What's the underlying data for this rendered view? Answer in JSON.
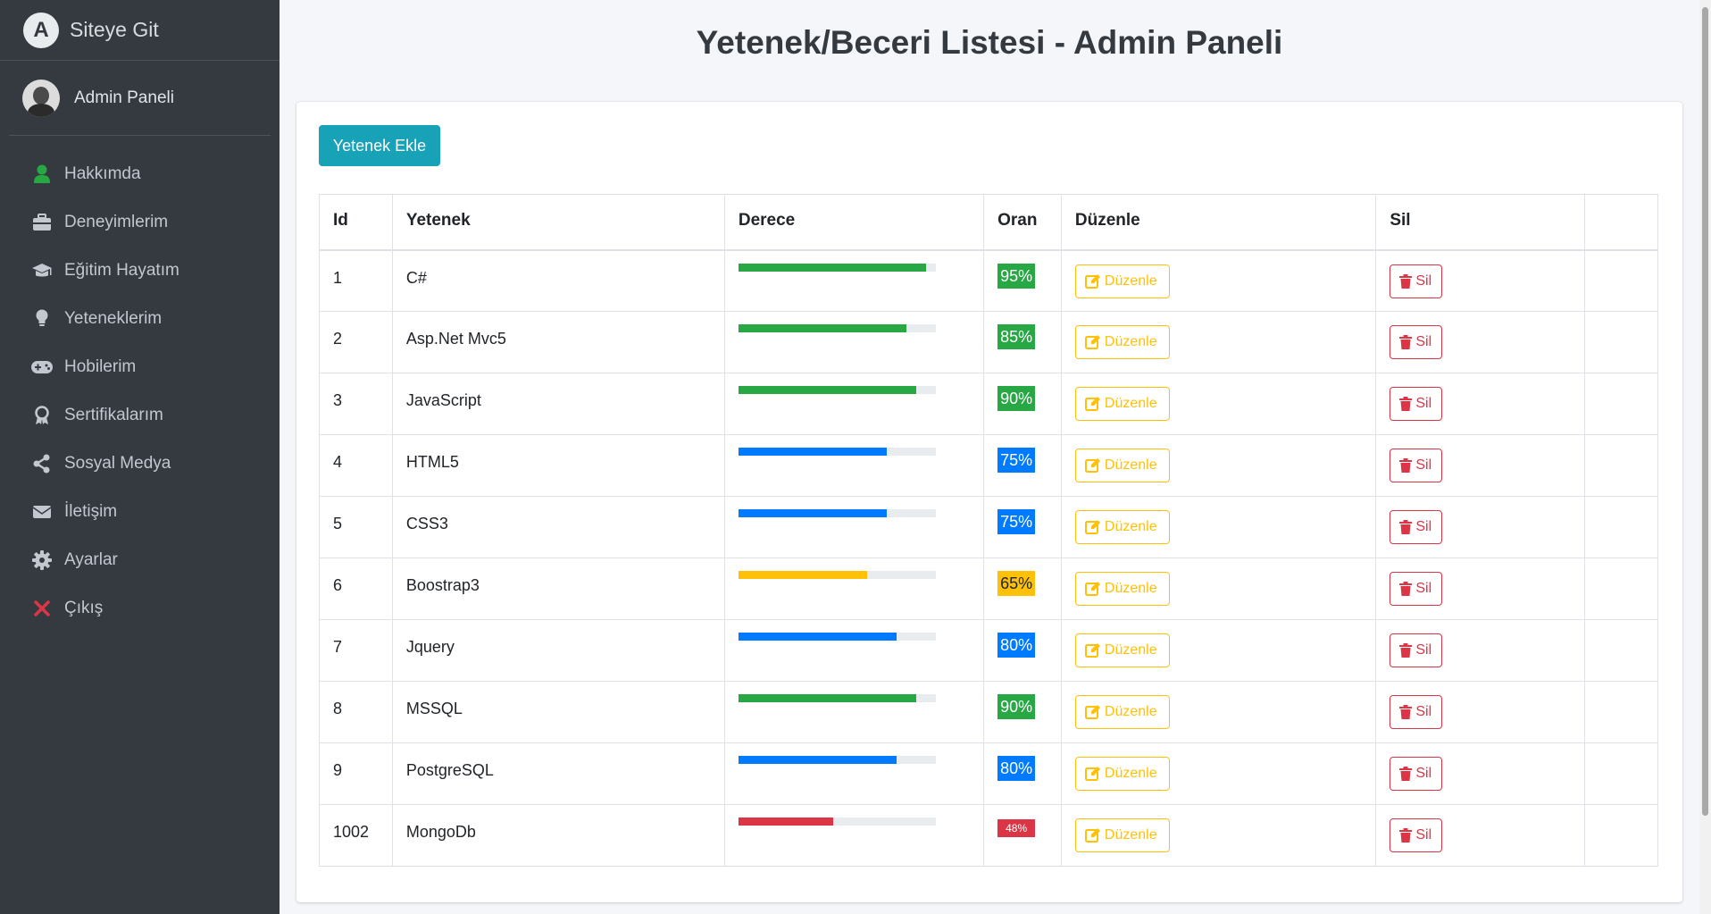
{
  "sidebar": {
    "brand_logo_letter": "A",
    "brand": "Siteye Git",
    "user": "Admin Paneli",
    "items": [
      {
        "label": "Hakkımda",
        "icon": "user-icon",
        "color": "#28a745"
      },
      {
        "label": "Deneyimlerim",
        "icon": "briefcase-icon",
        "color": "#c2c7d0"
      },
      {
        "label": "Eğitim Hayatım",
        "icon": "graduation-cap-icon",
        "color": "#c2c7d0"
      },
      {
        "label": "Yeteneklerim",
        "icon": "lightbulb-icon",
        "color": "#c2c7d0"
      },
      {
        "label": "Hobilerim",
        "icon": "gamepad-icon",
        "color": "#c2c7d0"
      },
      {
        "label": "Sertifikalarım",
        "icon": "award-icon",
        "color": "#c2c7d0"
      },
      {
        "label": "Sosyal Medya",
        "icon": "share-icon",
        "color": "#c2c7d0"
      },
      {
        "label": "İletişim",
        "icon": "envelope-icon",
        "color": "#c2c7d0"
      },
      {
        "label": "Ayarlar",
        "icon": "gear-icon",
        "color": "#c2c7d0"
      },
      {
        "label": "Çıkış",
        "icon": "close-icon",
        "color": "#dc3545"
      }
    ]
  },
  "main": {
    "title": "Yetenek/Beceri Listesi - Admin Paneli",
    "add_button": "Yetenek Ekle",
    "table": {
      "headers": [
        "Id",
        "Yetenek",
        "Derece",
        "Oran",
        "Düzenle",
        "Sil",
        ""
      ],
      "edit_label": "Düzenle",
      "delete_label": "Sil",
      "rows": [
        {
          "id": "1",
          "skill": "C#",
          "percent": 95,
          "oran": "95%",
          "color": "#28a745"
        },
        {
          "id": "2",
          "skill": "Asp.Net Mvc5",
          "percent": 85,
          "oran": "85%",
          "color": "#28a745"
        },
        {
          "id": "3",
          "skill": "JavaScript",
          "percent": 90,
          "oran": "90%",
          "color": "#28a745"
        },
        {
          "id": "4",
          "skill": "HTML5",
          "percent": 75,
          "oran": "75%",
          "color": "#007bff"
        },
        {
          "id": "5",
          "skill": "CSS3",
          "percent": 75,
          "oran": "75%",
          "color": "#007bff"
        },
        {
          "id": "6",
          "skill": "Boostrap3",
          "percent": 65,
          "oran": "65%",
          "color": "#ffc107"
        },
        {
          "id": "7",
          "skill": "Jquery",
          "percent": 80,
          "oran": "80%",
          "color": "#007bff"
        },
        {
          "id": "8",
          "skill": "MSSQL",
          "percent": 90,
          "oran": "90%",
          "color": "#28a745"
        },
        {
          "id": "9",
          "skill": "PostgreSQL",
          "percent": 80,
          "oran": "80%",
          "color": "#007bff"
        },
        {
          "id": "1002",
          "skill": "MongoDb",
          "percent": 48,
          "oran": "48%",
          "color": "#dc3545"
        }
      ]
    }
  }
}
